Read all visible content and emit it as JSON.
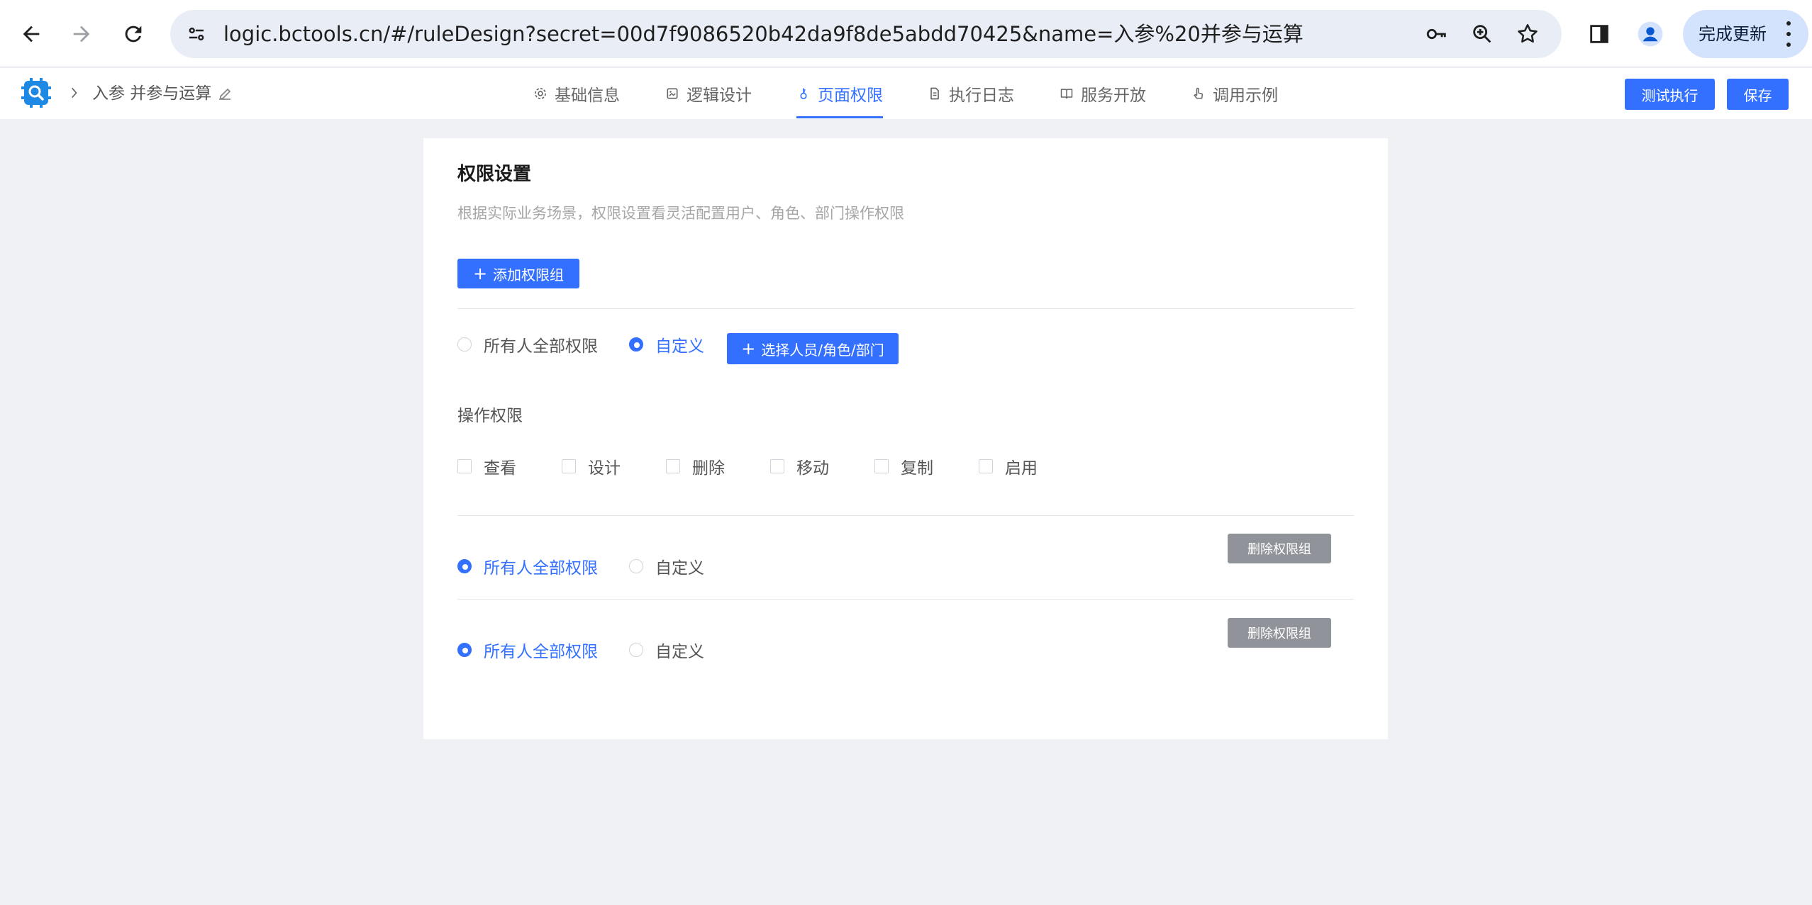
{
  "browser": {
    "url": "logic.bctools.cn/#/ruleDesign?secret=00d7f9086520b42da9f8de5abdd70425&name=入参%20并参与运算",
    "update_label": "完成更新"
  },
  "header": {
    "title": "入参 并参与运算",
    "tabs": [
      {
        "label": "基础信息",
        "icon": "settings-icon"
      },
      {
        "label": "逻辑设计",
        "icon": "image-icon"
      },
      {
        "label": "页面权限",
        "icon": "key-icon"
      },
      {
        "label": "执行日志",
        "icon": "document-icon"
      },
      {
        "label": "服务开放",
        "icon": "book-icon"
      },
      {
        "label": "调用示例",
        "icon": "pointer-icon"
      }
    ],
    "active_tab": "页面权限",
    "test_label": "测试执行",
    "save_label": "保存"
  },
  "permissions": {
    "title": "权限设置",
    "description": "根据实际业务场景，权限设置看灵活配置用户、角色、部门操作权限",
    "add_group_label": "添加权限组",
    "groups": [
      {
        "options": [
          {
            "label": "所有人全部权限",
            "checked": false
          },
          {
            "label": "自定义",
            "checked": true
          }
        ],
        "select_label": "选择人员/角色/部门",
        "operation_label": "操作权限",
        "operations": [
          "查看",
          "设计",
          "删除",
          "移动",
          "复制",
          "启用"
        ]
      },
      {
        "options": [
          {
            "label": "所有人全部权限",
            "checked": true
          },
          {
            "label": "自定义",
            "checked": false
          }
        ],
        "delete_label": "删除权限组"
      },
      {
        "options": [
          {
            "label": "所有人全部权限",
            "checked": true
          },
          {
            "label": "自定义",
            "checked": false
          }
        ],
        "delete_label": "删除权限组"
      }
    ]
  },
  "colors": {
    "accent": "#3370ff",
    "background": "#f0f1f5",
    "delete_button": "#909399"
  }
}
